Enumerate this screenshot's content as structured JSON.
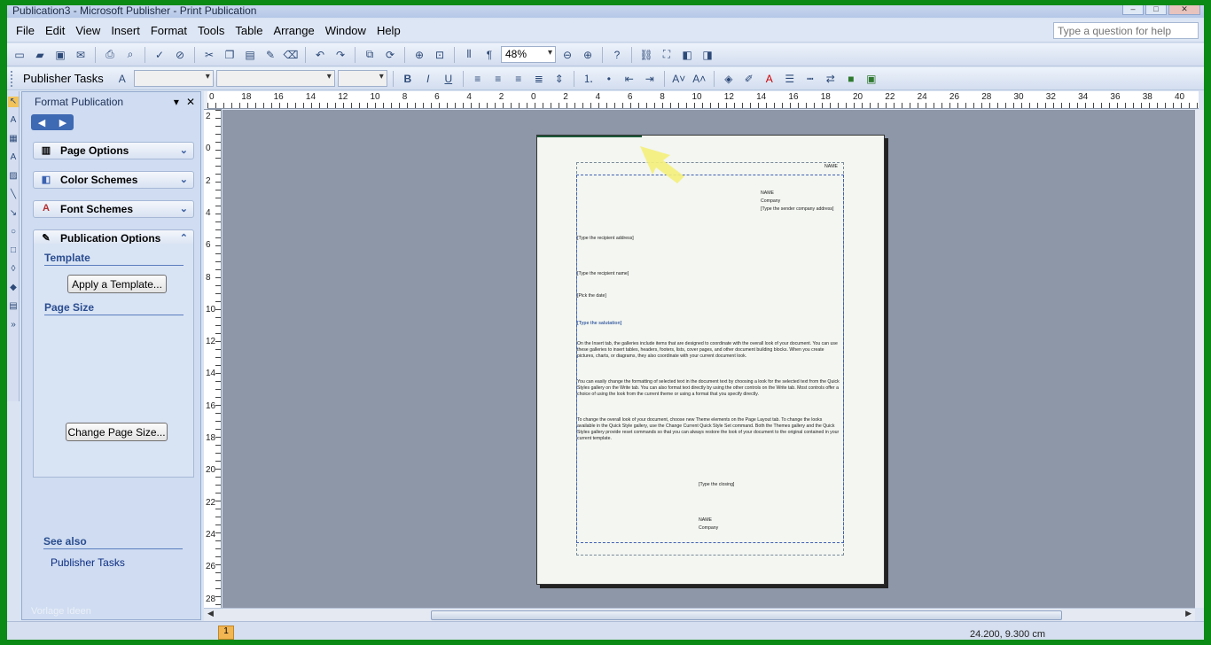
{
  "window": {
    "title": "Publication3 - Microsoft Publisher - Print Publication"
  },
  "menubar": {
    "items": [
      {
        "label": "File",
        "key": "F"
      },
      {
        "label": "Edit",
        "key": "E"
      },
      {
        "label": "View",
        "key": "V"
      },
      {
        "label": "Insert",
        "key": "I"
      },
      {
        "label": "Format",
        "key": "o"
      },
      {
        "label": "Tools",
        "key": "T"
      },
      {
        "label": "Table",
        "key": "a"
      },
      {
        "label": "Arrange",
        "key": "A"
      },
      {
        "label": "Window",
        "key": "W"
      },
      {
        "label": "Help",
        "key": "H"
      }
    ],
    "help_placeholder": "Type a question for help"
  },
  "toolbar": {
    "zoom": "48%",
    "publisher_tasks": "Publisher Tasks"
  },
  "taskpane": {
    "title": "Format Publication",
    "sections": {
      "page_options": "Page Options",
      "color_schemes": "Color Schemes",
      "font_schemes": "Font Schemes",
      "publication_options": "Publication Options"
    },
    "template_heading": "Template",
    "apply_template": "Apply a Template...",
    "page_size_heading": "Page Size",
    "change_page_size": "Change Page Size...",
    "see_also": "See also",
    "publisher_tasks_link": "Publisher Tasks",
    "watermark": "Vorlage Ideen"
  },
  "hruler_labels": [
    "0",
    "18",
    "16",
    "14",
    "12",
    "10",
    "8",
    "6",
    "4",
    "2",
    "0",
    "2",
    "4",
    "6",
    "8",
    "10",
    "12",
    "14",
    "16",
    "18",
    "20",
    "22",
    "24",
    "26",
    "28",
    "30",
    "32",
    "34",
    "36",
    "38",
    "40"
  ],
  "vruler_labels": [
    "2",
    "0",
    "2",
    "4",
    "6",
    "8",
    "10",
    "12",
    "14",
    "16",
    "18",
    "20",
    "22",
    "24",
    "26",
    "28"
  ],
  "document": {
    "header_name": "NAME",
    "sender_name": "NAME",
    "sender_company": "Company",
    "sender_address": "[Type the sender company address]",
    "recipient_address": "[Type the recipient address]",
    "recipient_name": "[Type the recipient name]",
    "date": "[Pick the date]",
    "salutation": "[Type the salutation]",
    "para1": "On the Insert tab, the galleries include items that are designed to coordinate with the overall look of your document. You can use these galleries to insert tables, headers, footers, lists, cover pages, and other document building blocks. When you create pictures, charts, or diagrams, they also coordinate with your current document look.",
    "para2": "You can easily change the formatting of selected text in the document text by choosing a look for the selected text from the Quick Styles gallery on the Write tab. You can also format text directly by using the other controls on the Write tab. Most controls offer a choice of using the look from the current theme or using a format that you specify directly.",
    "para3": "To change the overall look of your document, choose new Theme elements on the Page Layout tab. To change the looks available in the Quick Style gallery, use the Change Current Quick Style Set command. Both the Themes gallery and the Quick Styles gallery provide reset commands so that you can always restore the look of your document to the original contained in your current template.",
    "closing": "[Type the closing]",
    "footer_name": "NAME",
    "footer_company": "Company"
  },
  "status": {
    "page": "1",
    "coords": "24.200, 9.300 cm"
  },
  "colors": {
    "frame_green": "#0b8a16",
    "workspace_grey": "#8d97a8",
    "taskpane_blue": "#cfdcf1",
    "highlight_yellow": "#f4f07a"
  }
}
